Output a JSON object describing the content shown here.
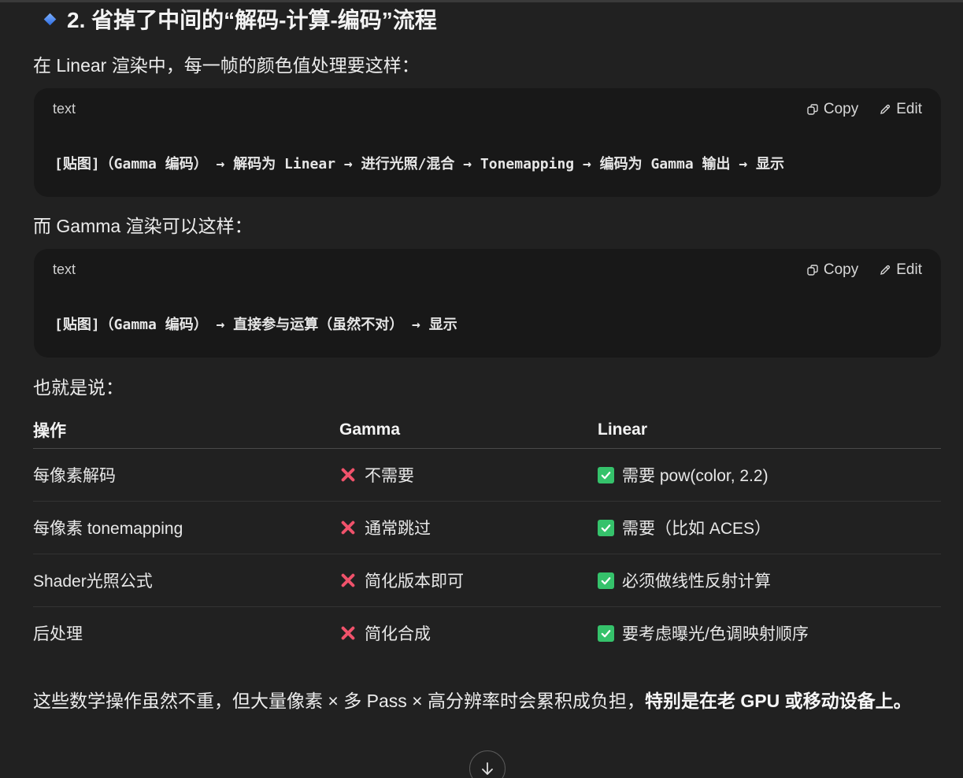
{
  "heading": "2. 省掉了中间的“解码-计算-编码”流程",
  "para1": "在 Linear 渲染中，每一帧的颜色值处理要这样：",
  "code1": {
    "lang": "text",
    "copy": "Copy",
    "edit": "Edit",
    "line": "[贴图]（Gamma 编码） → 解码为 Linear → 进行光照/混合 → Tonemapping → 编码为 Gamma 输出 → 显示"
  },
  "para2": "而 Gamma 渲染可以这样：",
  "code2": {
    "lang": "text",
    "copy": "Copy",
    "edit": "Edit",
    "line": "[贴图]（Gamma 编码） → 直接参与运算（虽然不对） → 显示"
  },
  "para3": "也就是说：",
  "table": {
    "headers": [
      "操作",
      "Gamma",
      "Linear"
    ],
    "rows": [
      [
        "每像素解码",
        "不需要",
        "需要 pow(color, 2.2)"
      ],
      [
        "每像素 tonemapping",
        "通常跳过",
        "需要（比如 ACES）"
      ],
      [
        "Shader光照公式",
        "简化版本即可",
        "必须做线性反射计算"
      ],
      [
        "后处理",
        "简化合成",
        "要考虑曝光/色调映射顺序"
      ]
    ]
  },
  "summary": {
    "normal": "这些数学操作虽然不重，但大量像素 × 多 Pass × 高分辨率时会累积成负担，",
    "bold": "特别是在老 GPU 或移动设备上。"
  },
  "colors": {
    "background": "#212121",
    "code_bg": "#181818",
    "cross": "#f0526b",
    "check": "#35c26b",
    "diamond": "#3b82f6"
  },
  "icons": {
    "heading_bullet": "blue-diamond-icon",
    "copy": "copy-icon",
    "edit": "pencil-icon",
    "no": "red-cross-icon",
    "yes": "green-check-icon",
    "scroll": "arrow-down-icon"
  }
}
